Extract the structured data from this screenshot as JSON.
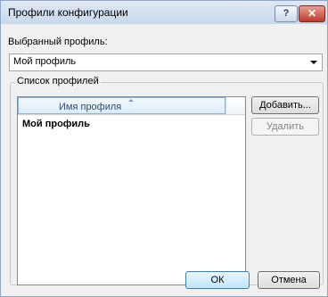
{
  "window": {
    "title": "Профили конфигурации",
    "help_label": "?",
    "close_label": "✕"
  },
  "selected_profile": {
    "label": "Выбранный профиль:",
    "value": "Мой профиль"
  },
  "profiles_group": {
    "legend": "Список профилей",
    "column_header": "Имя профиля",
    "rows": [
      "Мой профиль"
    ],
    "add_label": "Добавить...",
    "delete_label": "Удалить"
  },
  "footer": {
    "ok_label": "ОК",
    "cancel_label": "Отмена"
  }
}
